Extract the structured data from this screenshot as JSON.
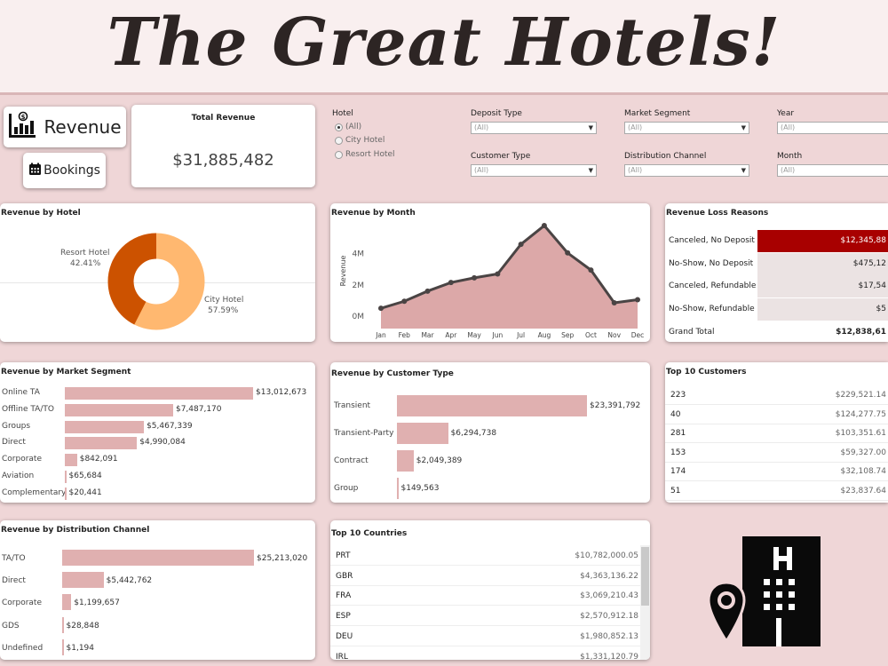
{
  "header": {
    "title": "The Great Hotels!"
  },
  "nav": {
    "revenue_label": "Revenue",
    "bookings_label": "Bookings"
  },
  "total_revenue": {
    "title": "Total Revenue",
    "value": "$31,885,482"
  },
  "filters": {
    "hotel": {
      "label": "Hotel",
      "options": [
        "(All)",
        "City Hotel",
        "Resort Hotel"
      ],
      "selected": "(All)"
    },
    "deposit_type": {
      "label": "Deposit Type",
      "value": "(All)"
    },
    "market_segment": {
      "label": "Market Segment",
      "value": "(All)"
    },
    "year": {
      "label": "Year",
      "value": "(All)"
    },
    "customer_type": {
      "label": "Customer Type",
      "value": "(All)"
    },
    "distribution_channel": {
      "label": "Distribution Channel",
      "value": "(All)"
    },
    "month": {
      "label": "Month",
      "value": "(All)"
    }
  },
  "revenue_by_hotel": {
    "title": "Revenue by Hotel",
    "slices": [
      {
        "name": "Resort Hotel",
        "pct_label": "42.41%",
        "value": 42.41,
        "color": "#cc5200"
      },
      {
        "name": "City Hotel",
        "pct_label": "57.59%",
        "value": 57.59,
        "color": "#ffb870"
      }
    ]
  },
  "revenue_by_month": {
    "title": "Revenue by Month"
  },
  "revenue_loss": {
    "title": "Revenue Loss Reasons",
    "rows": [
      {
        "label": "Canceled, No Deposit",
        "value": "$12,345,88",
        "highlight": true
      },
      {
        "label": "No-Show, No Deposit",
        "value": "$475,12"
      },
      {
        "label": "Canceled, Refundable",
        "value": "$17,54"
      },
      {
        "label": "No-Show, Refundable",
        "value": "$5"
      }
    ],
    "total_label": "Grand Total",
    "total_value": "$12,838,61",
    "highlight_color": "#a80000"
  },
  "market_segment": {
    "title": "Revenue by Market Segment",
    "rows": [
      {
        "label": "Online TA",
        "value": 13012673,
        "display": "$13,012,673"
      },
      {
        "label": "Offline TA/TO",
        "value": 7487170,
        "display": "$7,487,170"
      },
      {
        "label": "Groups",
        "value": 5467339,
        "display": "$5,467,339"
      },
      {
        "label": "Direct",
        "value": 4990084,
        "display": "$4,990,084"
      },
      {
        "label": "Corporate",
        "value": 842091,
        "display": "$842,091"
      },
      {
        "label": "Aviation",
        "value": 65684,
        "display": "$65,684"
      },
      {
        "label": "Complementary",
        "value": 20441,
        "display": "$20,441"
      }
    ]
  },
  "customer_type": {
    "title": "Revenue by Customer Type",
    "rows": [
      {
        "label": "Transient",
        "value": 23391792,
        "display": "$23,391,792"
      },
      {
        "label": "Transient-Party",
        "value": 6294738,
        "display": "$6,294,738"
      },
      {
        "label": "Contract",
        "value": 2049389,
        "display": "$2,049,389"
      },
      {
        "label": "Group",
        "value": 149563,
        "display": "$149,563"
      }
    ]
  },
  "top_customers": {
    "title": "Top 10 Customers",
    "rows": [
      {
        "id": "223",
        "value": "$229,521.14"
      },
      {
        "id": "40",
        "value": "$124,277.75"
      },
      {
        "id": "281",
        "value": "$103,351.61"
      },
      {
        "id": "153",
        "value": "$59,327.00"
      },
      {
        "id": "174",
        "value": "$32,108.74"
      },
      {
        "id": "51",
        "value": "$23,837.64"
      }
    ]
  },
  "distribution_channel": {
    "title": "Revenue by Distribution Channel",
    "rows": [
      {
        "label": "TA/TO",
        "value": 25213020,
        "display": "$25,213,020"
      },
      {
        "label": "Direct",
        "value": 5442762,
        "display": "$5,442,762"
      },
      {
        "label": "Corporate",
        "value": 1199657,
        "display": "$1,199,657"
      },
      {
        "label": "GDS",
        "value": 28848,
        "display": "$28,848"
      },
      {
        "label": "Undefined",
        "value": 1194,
        "display": "$1,194"
      }
    ]
  },
  "top_countries": {
    "title": "Top 10 Countries",
    "rows": [
      {
        "code": "PRT",
        "value": "$10,782,000.05"
      },
      {
        "code": "GBR",
        "value": "$4,363,136.22"
      },
      {
        "code": "FRA",
        "value": "$3,069,210.43"
      },
      {
        "code": "ESP",
        "value": "$2,570,912.18"
      },
      {
        "code": "DEU",
        "value": "$1,980,852.13"
      },
      {
        "code": "IRL",
        "value": "$1,331,120.79"
      }
    ]
  },
  "logo": {
    "icon": "hotel-location-icon"
  },
  "chart_data": {
    "type": "area",
    "title": "Revenue by Month",
    "xlabel": "",
    "ylabel": "Revenue",
    "categories": [
      "Jan",
      "Feb",
      "Mar",
      "Apr",
      "May",
      "Jun",
      "Jul",
      "Aug",
      "Sep",
      "Oct",
      "Nov",
      "Dec"
    ],
    "values": [
      0.5,
      0.95,
      1.6,
      2.15,
      2.45,
      2.7,
      4.6,
      5.8,
      4.05,
      2.95,
      0.85,
      1.05
    ],
    "value_unit": "M",
    "yticks": [
      "0M",
      "2M",
      "4M"
    ],
    "ytick_values": [
      0,
      2,
      4
    ],
    "ylim": [
      -0.8,
      6.2
    ],
    "fill_color": "#dca8a8",
    "line_color": "#4a4444",
    "grid": false
  }
}
